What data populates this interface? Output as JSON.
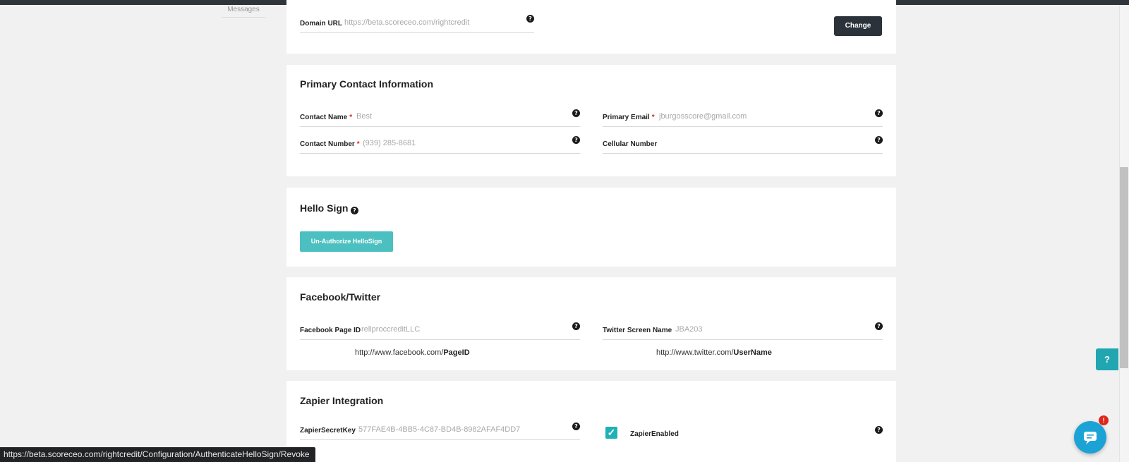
{
  "sidebar": {
    "messages_label": "Messages"
  },
  "domain": {
    "label": "Domain URL",
    "value": "https://beta.scoreceo.com/rightcredit",
    "change_label": "Change"
  },
  "primary_contact": {
    "title": "Primary Contact Information",
    "contact_name": {
      "label": "Contact Name",
      "value": "Best"
    },
    "primary_email": {
      "label": "Primary Email",
      "value": "jburgosscore@gmail.com"
    },
    "contact_number": {
      "label": "Contact Number",
      "value": "(939) 285-8681"
    },
    "cellular_number": {
      "label": "Cellular Number",
      "value": ""
    }
  },
  "hello_sign": {
    "title": "Hello Sign",
    "button_label": "Un-Authorize HelloSign"
  },
  "facebook_twitter": {
    "title": "Facebook/Twitter",
    "facebook": {
      "label": "Facebook Page ID",
      "value": "rellproccreditLLC",
      "hint_prefix": "http://www.facebook.com/",
      "hint_bold": "PageID"
    },
    "twitter": {
      "label": "Twitter Screen Name",
      "value": "JBA203",
      "hint_prefix": "http://www.twitter.com/",
      "hint_bold": "UserName"
    }
  },
  "zapier": {
    "title": "Zapier Integration",
    "secret_key": {
      "label": "ZapierSecretKey",
      "value": "577FAE4B-4BB5-4C87-BD4B-8982AFAF4DD7"
    },
    "enabled": {
      "label": "ZapierEnabled",
      "checked": true
    }
  },
  "required_marker": "*",
  "help_glyph": "?",
  "help_tab_glyph": "?",
  "chat_badge": "!",
  "status_bar_url": "https://beta.scoreceo.com/rightcredit/Configuration/AuthenticateHelloSign/Revoke",
  "colors": {
    "accent_teal": "#4cc0c0",
    "dark_button": "#2b323a",
    "required": "#e02424",
    "chat": "#1ca3d6",
    "badge": "#e0271b"
  }
}
